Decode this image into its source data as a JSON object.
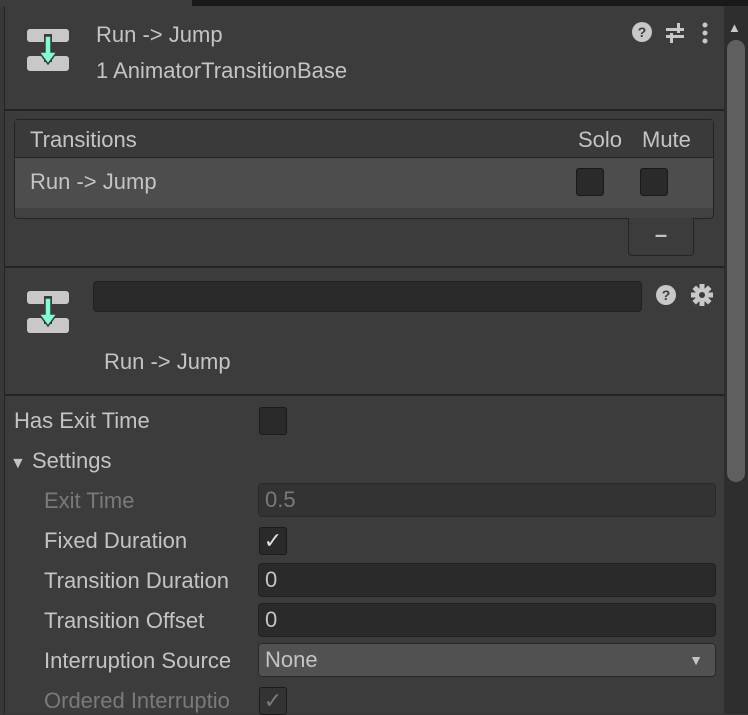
{
  "header": {
    "title": "Run -> Jump",
    "subtitle": "1 AnimatorTransitionBase"
  },
  "transitions": {
    "header": "Transitions",
    "solo": "Solo",
    "mute": "Mute",
    "rows": [
      {
        "label": "Run -> Jump",
        "solo": false,
        "mute": false
      }
    ],
    "remove_label": "–"
  },
  "transition": {
    "name_value": "",
    "title": "Run -> Jump"
  },
  "props": {
    "has_exit_time": {
      "label": "Has Exit Time",
      "checked": false
    },
    "settings": {
      "label": "Settings"
    },
    "exit_time": {
      "label": "Exit Time",
      "value": "0.5"
    },
    "fixed_duration": {
      "label": "Fixed Duration",
      "check": "✓"
    },
    "transition_duration": {
      "label": "Transition Duration",
      "value": "0"
    },
    "transition_offset": {
      "label": "Transition Offset",
      "value": "0"
    },
    "interruption_source": {
      "label": "Interruption Source",
      "value": "None"
    },
    "ordered_interruption": {
      "label": "Ordered Interruptio",
      "check": "✓"
    }
  },
  "colors": {
    "accent": "#7fffd4",
    "bg": "#3c3c3c",
    "text": "#c4c4c4"
  }
}
